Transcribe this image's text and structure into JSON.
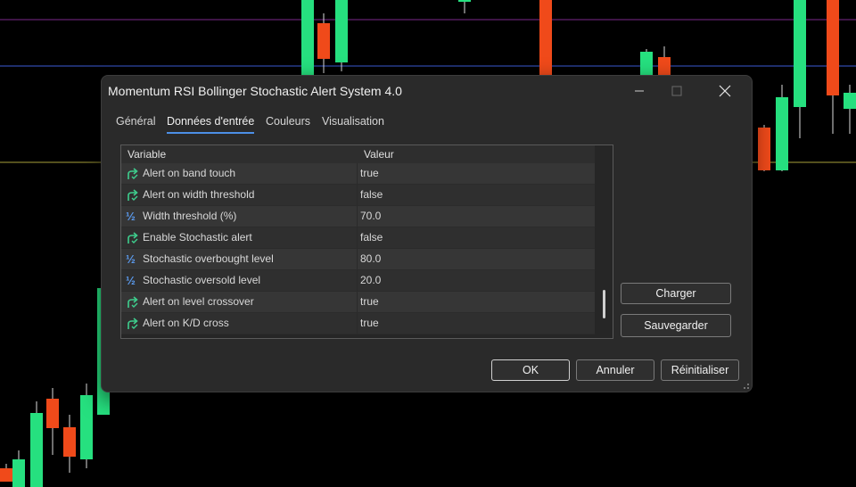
{
  "dialog": {
    "title": "Momentum RSI Bollinger Stochastic Alert System 4.0",
    "tabs": [
      {
        "label": "Général"
      },
      {
        "label": "Données d'entrée"
      },
      {
        "label": "Couleurs"
      },
      {
        "label": "Visualisation"
      }
    ],
    "active_tab": "Données d'entrée",
    "table": {
      "headers": {
        "variable": "Variable",
        "value": "Valeur"
      },
      "rows": [
        {
          "icon": "bool-arrow-icon",
          "name": "Alert on band touch",
          "value": "true"
        },
        {
          "icon": "bool-arrow-icon",
          "name": "Alert on width threshold",
          "value": "false"
        },
        {
          "icon": "fraction-icon",
          "name": "Width threshold (%)",
          "value": "70.0"
        },
        {
          "icon": "bool-arrow-icon",
          "name": "Enable Stochastic alert",
          "value": "false"
        },
        {
          "icon": "fraction-icon",
          "name": "Stochastic overbought level",
          "value": "80.0"
        },
        {
          "icon": "fraction-icon",
          "name": "Stochastic oversold level",
          "value": "20.0"
        },
        {
          "icon": "bool-arrow-icon",
          "name": "Alert on level crossover",
          "value": "true"
        },
        {
          "icon": "bool-arrow-icon",
          "name": "Alert on K/D cross",
          "value": "true"
        }
      ]
    },
    "side_buttons": {
      "load": "Charger",
      "save": "Sauvegarder"
    },
    "footer_buttons": {
      "ok": "OK",
      "cancel": "Annuler",
      "reset": "Réinitialiser"
    }
  },
  "colors": {
    "bull_candle": "#26e07f",
    "bear_candle": "#f04a1a",
    "accent": "#4c8fe6",
    "icon_green": "#3ecf8e"
  }
}
